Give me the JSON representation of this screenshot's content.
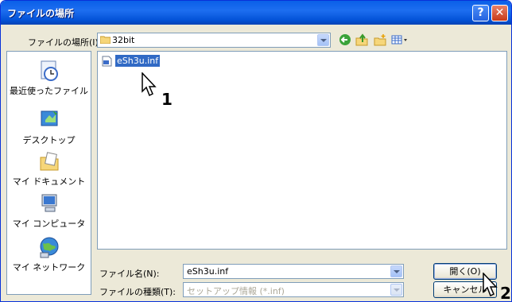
{
  "dialog": {
    "title": "ファイルの場所",
    "help_label": "?",
    "close_label": "✕"
  },
  "location": {
    "label": "ファイルの場所(I):",
    "value": "32bit"
  },
  "places": [
    {
      "label": "最近使ったファイル",
      "icon": "recent-documents-icon"
    },
    {
      "label": "デスクトップ",
      "icon": "desktop-icon"
    },
    {
      "label": "マイ ドキュメント",
      "icon": "my-documents-icon"
    },
    {
      "label": "マイ コンピュータ",
      "icon": "my-computer-icon"
    },
    {
      "label": "マイ ネットワーク",
      "icon": "my-network-icon"
    }
  ],
  "files": [
    {
      "name": "eSh3u.inf",
      "selected": true
    }
  ],
  "filename": {
    "label": "ファイル名(N):",
    "value": "eSh3u.inf"
  },
  "filetype": {
    "label": "ファイルの種類(T):",
    "value": "セットアップ情報 (*.inf)"
  },
  "buttons": {
    "open": "開く(O)",
    "cancel": "キャンセル"
  },
  "callouts": {
    "one": "1",
    "two": "2"
  },
  "colors": {
    "titlebar": "#0a5fe8",
    "selection": "#316ac5"
  }
}
